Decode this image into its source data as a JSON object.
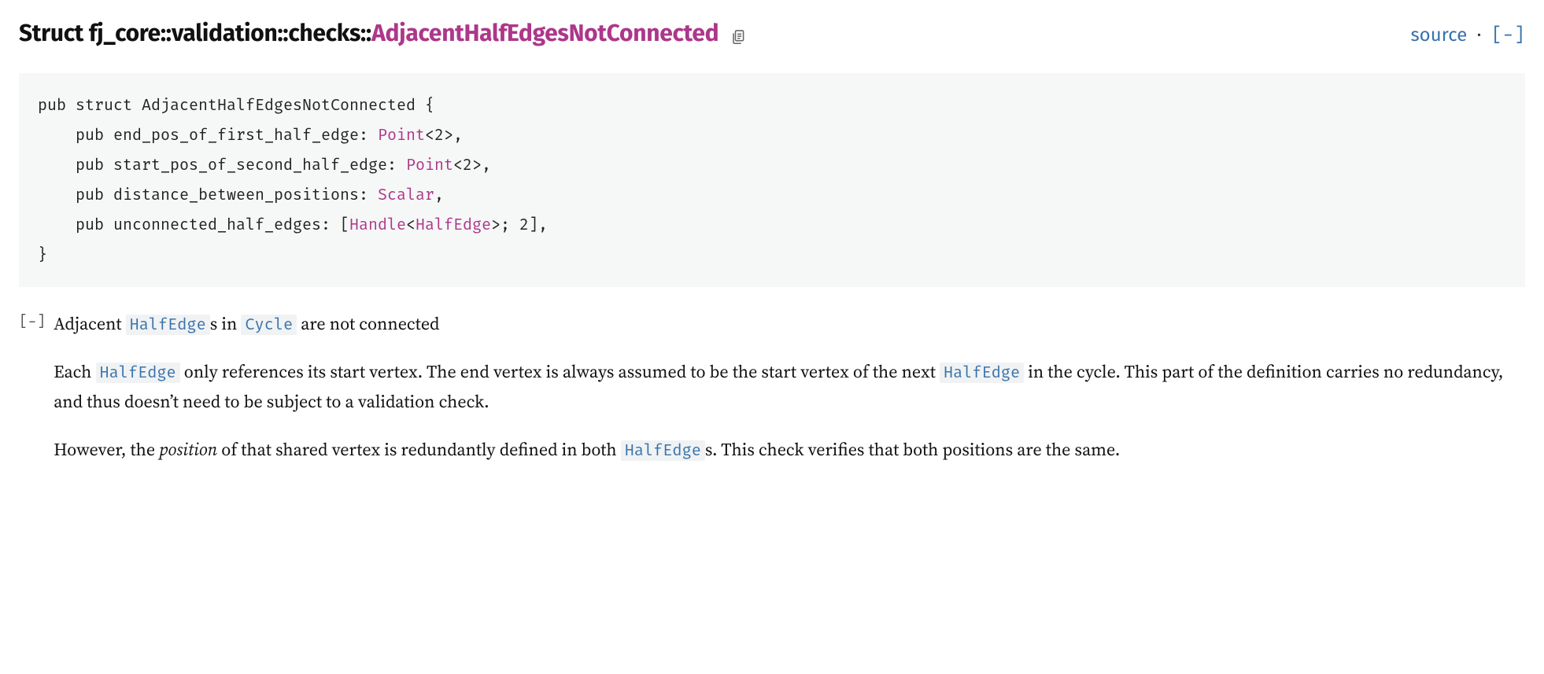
{
  "header": {
    "kind": "Struct",
    "path": [
      "fj_core",
      "validation",
      "checks"
    ],
    "type_name": "AdjacentHalfEdgesNotConnected",
    "source_label": "source",
    "collapse_label": "[−]"
  },
  "code": {
    "l1_a": "pub struct AdjacentHalfEdgesNotConnected {",
    "l2_a": "    pub end_pos_of_first_half_edge: ",
    "l2_t": "Point",
    "l2_b": "<2>,",
    "l3_a": "    pub start_pos_of_second_half_edge: ",
    "l3_t": "Point",
    "l3_b": "<2>,",
    "l4_a": "    pub distance_between_positions: ",
    "l4_t": "Scalar",
    "l4_b": ",",
    "l5_a": "    pub unconnected_half_edges: [",
    "l5_t1": "Handle",
    "l5_m": "<",
    "l5_t2": "HalfEdge",
    "l5_b": ">; 2],",
    "l6": "}"
  },
  "doc": {
    "toggle": "[−]",
    "p1_a": "Adjacent ",
    "p1_he": "HalfEdge",
    "p1_b": "s in ",
    "p1_cy": "Cycle",
    "p1_c": " are not connected",
    "p2_a": "Each ",
    "p2_he1": "HalfEdge",
    "p2_b": " only references its start vertex. The end vertex is always assumed to be the start vertex of the next ",
    "p2_he2": "HalfEdge",
    "p2_c": " in the cycle. This part of the definition carries no redundancy, and thus doesn’t need to be subject to a validation check.",
    "p3_a": "However, the ",
    "p3_em": "position",
    "p3_b": " of that shared vertex is redundantly defined in both ",
    "p3_he": "HalfEdge",
    "p3_c": "s. This check verifies that both positions are the same."
  }
}
